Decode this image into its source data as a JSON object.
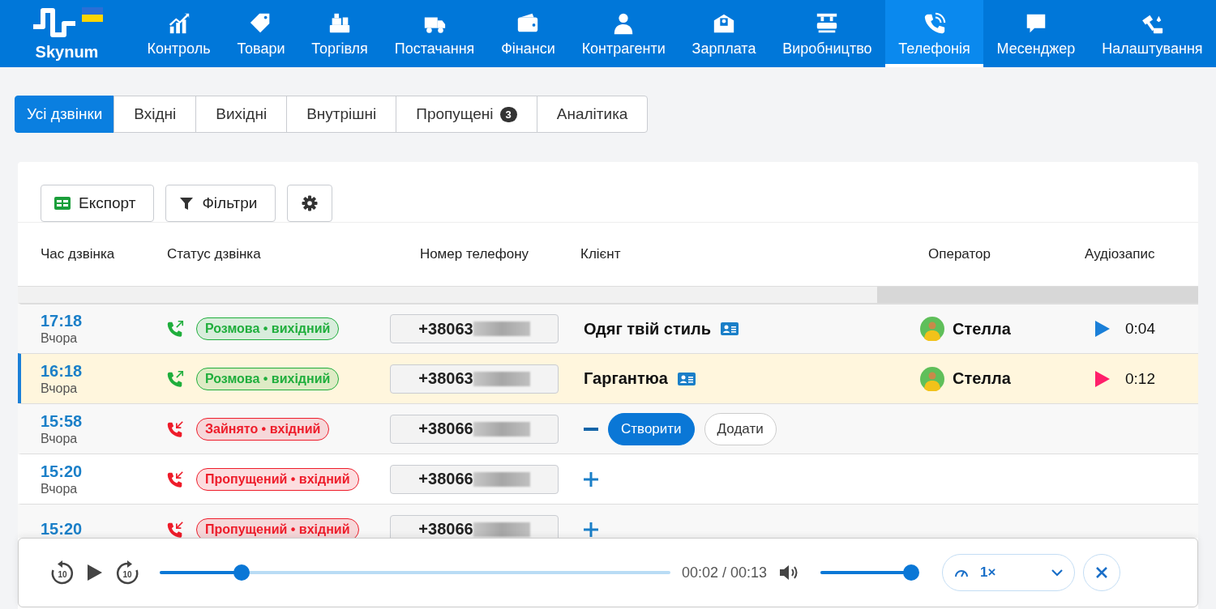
{
  "nav": {
    "logo": "Skynum",
    "items": [
      {
        "label": "Контроль",
        "selected": false
      },
      {
        "label": "Товари",
        "selected": false
      },
      {
        "label": "Торгівля",
        "selected": false
      },
      {
        "label": "Постачання",
        "selected": false
      },
      {
        "label": "Фінанси",
        "selected": false
      },
      {
        "label": "Контрагенти",
        "selected": false
      },
      {
        "label": "Зарплата",
        "selected": false
      },
      {
        "label": "Виробництво",
        "selected": false
      },
      {
        "label": "Телефонія",
        "selected": true
      },
      {
        "label": "Месенджер",
        "selected": false
      },
      {
        "label": "Налаштування",
        "selected": false
      }
    ]
  },
  "tabs": [
    {
      "label": "Усі дзвінки",
      "selected": true
    },
    {
      "label": "Вхідні",
      "selected": false
    },
    {
      "label": "Вихідні",
      "selected": false
    },
    {
      "label": "Внутрішні",
      "selected": false
    },
    {
      "label": "Пропущені",
      "badge": "3",
      "selected": false
    },
    {
      "label": "Аналітика",
      "selected": false
    }
  ],
  "toolbar": {
    "export": "Експорт",
    "filters": "Фільтри"
  },
  "table": {
    "columns": [
      "Час дзвінка",
      "Статус дзвінка",
      "Номер телефону",
      "Клієнт",
      "Оператор",
      "Аудіозапис"
    ],
    "rows": [
      {
        "time": "17:18",
        "date": "Вчора",
        "kind": "outgoing",
        "status": "Розмова • вихідний",
        "color": "#1fae3c",
        "phone": "+38063",
        "client": {
          "kind": "name",
          "name": "Одяг твій стиль"
        },
        "operator": "Стелла",
        "audio": {
          "duration": "0:04",
          "playing": false
        },
        "selected": false
      },
      {
        "time": "16:18",
        "date": "Вчора",
        "kind": "outgoing",
        "status": "Розмова • вихідний",
        "color": "#1fae3c",
        "phone": "+38063",
        "client": {
          "kind": "name",
          "name": "Гаргантюа"
        },
        "operator": "Стелла",
        "audio": {
          "duration": "0:12",
          "playing": true
        },
        "selected": true
      },
      {
        "time": "15:58",
        "date": "Вчора",
        "kind": "incoming",
        "status": "Зайнято • вхідний",
        "color": "#ee1c2a",
        "phone": "+38066",
        "client": {
          "kind": "actions",
          "create": "Створити",
          "add": "Додати"
        },
        "selected": false
      },
      {
        "time": "15:20",
        "date": "Вчора",
        "kind": "incoming",
        "status": "Пропущений • вхідний",
        "color": "#ee1c2a",
        "phone": "+38066",
        "client": {
          "kind": "add"
        },
        "selected": false
      },
      {
        "time": "15:20",
        "kind": "incoming",
        "status": "Пропущений • вхідний",
        "color": "#ee1c2a",
        "phone": "+38066",
        "client": {
          "kind": "add"
        },
        "selected": false
      }
    ]
  },
  "player": {
    "skip_back": "10",
    "skip_forward": "10",
    "progress": {
      "level": 0.16
    },
    "time": "00:02 / 00:13",
    "volume": {
      "level": 1
    },
    "speed": "1×"
  }
}
